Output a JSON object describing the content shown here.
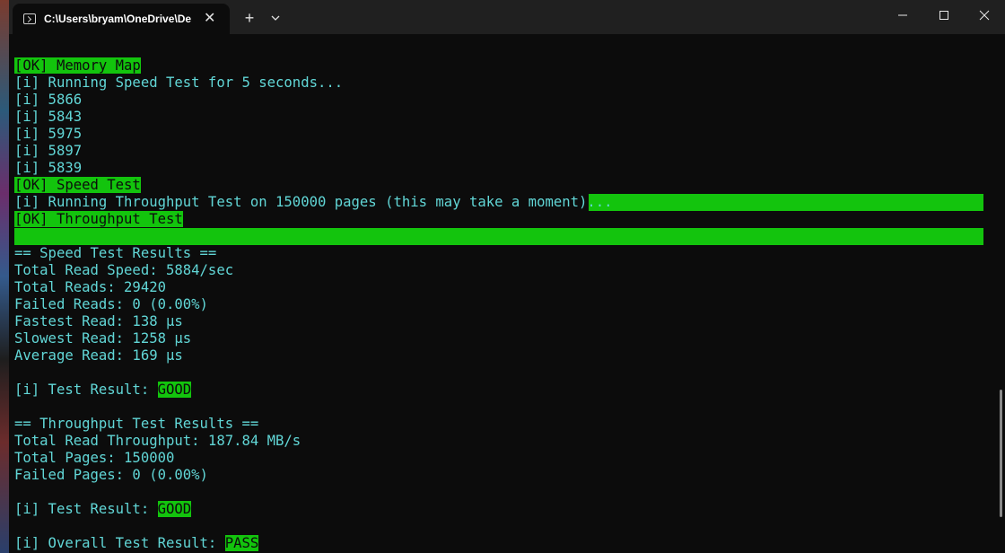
{
  "window": {
    "tab_title": "C:\\Users\\bryam\\OneDrive\\De",
    "new_tab_glyph": "+",
    "close_tab_glyph": "✕",
    "icons": [
      "terminal-icon",
      "close-icon",
      "plus-icon",
      "chevron-down-icon",
      "minimize-icon",
      "maximize-icon",
      "close-window-icon"
    ]
  },
  "colors": {
    "background": "#0c0c0c",
    "text": "#61d6d6",
    "highlight": "#13c40d",
    "titlebar": "#202020"
  },
  "terminal": {
    "lines": [
      {
        "ok": "[OK] Memory Map"
      },
      {
        "text": "[i] Running Speed Test for 5 seconds..."
      },
      {
        "text": "[i] 5866"
      },
      {
        "text": "[i] 5843"
      },
      {
        "text": "[i] 5975"
      },
      {
        "text": "[i] 5897"
      },
      {
        "text": "[i] 5839"
      },
      {
        "ok": "[OK] Speed Test"
      },
      {
        "text": "[i] Running Throughput Test on 150000 pages (this may take a moment)..."
      },
      {
        "ok": "[OK] Throughput Test"
      },
      {
        "text": "== Speed Test Results =="
      },
      {
        "text": "Total Read Speed: 5884/sec"
      },
      {
        "text": "Total Reads: 29420"
      },
      {
        "text": "Failed Reads: 0 (0.00%)"
      },
      {
        "text": "Fastest Read: 138 µs"
      },
      {
        "text": "Slowest Read: 1258 µs"
      },
      {
        "text": "Average Read: 169 µs"
      },
      {
        "prefix": "[i] Test Result: ",
        "badge": "GOOD"
      },
      {
        "text": "== Throughput Test Results =="
      },
      {
        "text": "Total Read Throughput: 187.84 MB/s"
      },
      {
        "text": "Total Pages: 150000"
      },
      {
        "text": "Failed Pages: 0 (0.00%)"
      },
      {
        "prefix": "[i] Test Result: ",
        "badge": "GOOD"
      },
      {
        "prefix": "[i] Overall Test Result: ",
        "badge": "PASS"
      }
    ]
  }
}
